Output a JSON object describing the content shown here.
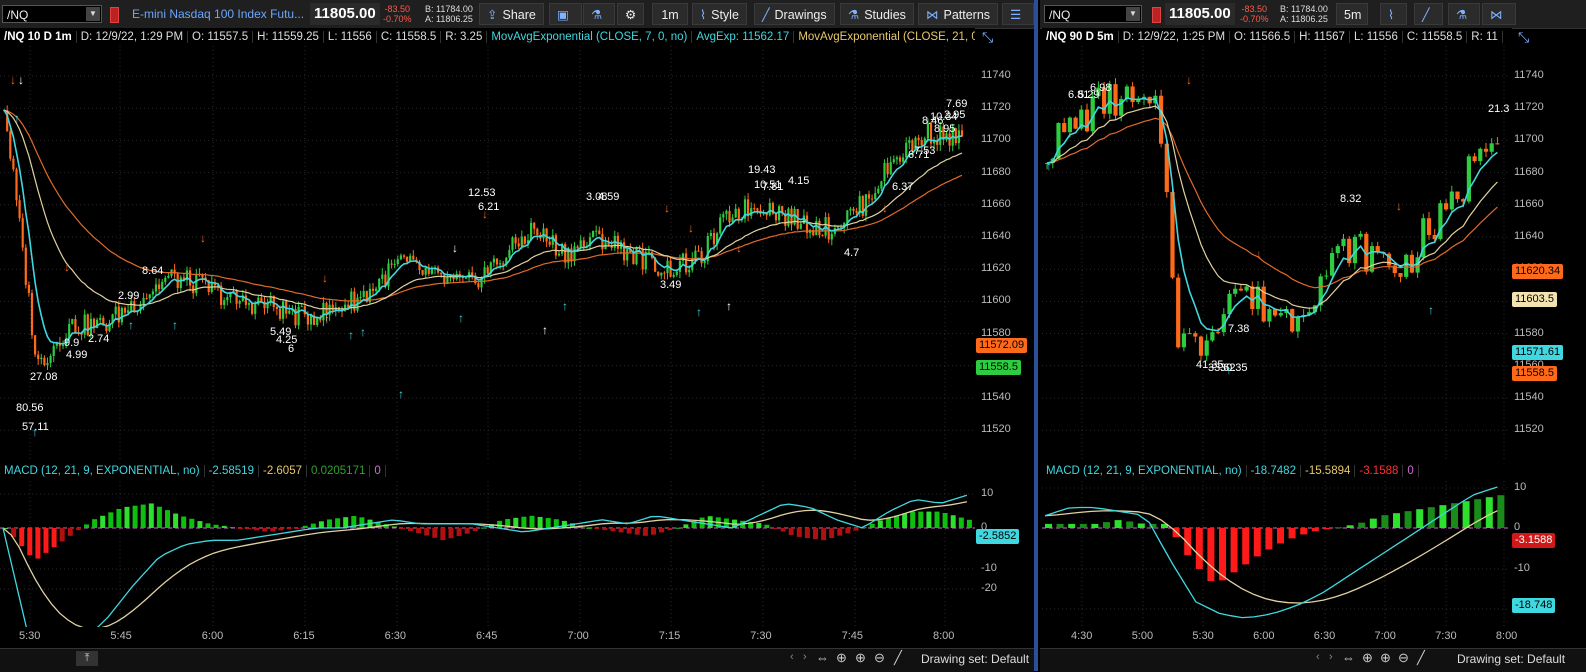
{
  "left": {
    "symbol": "/NQ",
    "description": "E-mini Nasdaq 100 Index Futu...",
    "last_price": "11805.00",
    "change": "-83.50",
    "change_pct": "-0.70%",
    "bid": "B: 11784.00",
    "ask": "A: 11806.25",
    "toolbar": {
      "share": "Share",
      "timeframe": "1m",
      "style": "Style",
      "drawings": "Drawings",
      "studies": "Studies",
      "patterns": "Patterns"
    },
    "header": {
      "title": "/NQ 10 D 1m",
      "date": "D: 12/9/22, 1:29 PM",
      "open": "O: 11557.5",
      "high": "H: 11559.25",
      "low": "L: 11556",
      "close": "C: 11558.5",
      "range": "R: 3.25",
      "study1": "MovAvgExponential (CLOSE, 7, 0, no)",
      "study1_val": "AvgExp: 11562.17",
      "study2": "MovAvgExponential (CLOSE, 21, 0,..."
    },
    "price_axis": [
      "11740",
      "11720",
      "11700",
      "11680",
      "11660",
      "11640",
      "11620",
      "11600",
      "11580",
      "11560",
      "11540",
      "11520"
    ],
    "price_tags": {
      "tag1": "11572.09",
      "tag2": "11558.5"
    },
    "annotations": [
      "80.56",
      "57.11",
      "27.08",
      "9.9",
      "4.99",
      "2.74",
      "2.99",
      "8.64",
      "5.49",
      "4.25",
      "6",
      "12.53",
      "6.21",
      "3.08",
      "4.59",
      "3.49",
      "19.43",
      "10.51",
      "7.81",
      "4.15",
      "4.7",
      "6.37",
      "6.71",
      "7.53",
      "8.46",
      "10.34",
      "8.95",
      "2.95",
      "7.69"
    ],
    "macd": {
      "label": "MACD (12, 21, 9, EXPONENTIAL, no)",
      "v1": "-2.58519",
      "v2": "-2.6057",
      "v3": "0.0205171",
      "v4": "0",
      "tag": "-2.5852",
      "axis": [
        "10",
        "0",
        "-10",
        "-20"
      ]
    },
    "time_axis": [
      "5:30",
      "5:45",
      "6:00",
      "6:15",
      "6:30",
      "6:45",
      "7:00",
      "7:15",
      "7:30",
      "7:45",
      "8:00"
    ]
  },
  "right": {
    "symbol": "/NQ",
    "last_price": "11805.00",
    "change": "-83.50",
    "change_pct": "-0.70%",
    "bid": "B: 11784.00",
    "ask": "A: 11806.25",
    "timeframe": "5m",
    "header": {
      "title": "/NQ 90 D 5m",
      "date": "D: 12/9/22, 1:25 PM",
      "open": "O: 11566.5",
      "high": "H: 11567",
      "low": "L: 11556",
      "close": "C: 11558.5",
      "range": "R: 11"
    },
    "price_axis": [
      "11740",
      "11720",
      "11700",
      "11680",
      "11660",
      "11640",
      "11620",
      "11600",
      "11580",
      "11560",
      "11540",
      "11520"
    ],
    "price_tags": {
      "tag1": "11620.34",
      "tag2": "11603.5",
      "tag3": "11571.61",
      "tag4": "11558.5"
    },
    "annotations": [
      "6.81",
      "5.29",
      "6.98",
      "41.35",
      "33.62",
      "30.35",
      "7.38",
      "8.32",
      "21.3"
    ],
    "macd": {
      "label": "MACD (12, 21, 9, EXPONENTIAL, no)",
      "v1": "-18.7482",
      "v2": "-15.5894",
      "v3": "-3.1588",
      "v4": "0",
      "tag1": "-3.1588",
      "tag2": "-18.748",
      "axis": [
        "10",
        "0",
        "-10",
        "-20"
      ]
    },
    "time_axis": [
      "4:30",
      "5:00",
      "5:30",
      "6:00",
      "6:30",
      "7:00",
      "7:30",
      "8:00"
    ]
  },
  "footer": {
    "drawing_set_left": "Drawing set: Default",
    "drawing_set_right": "Drawing set: Default"
  },
  "colors": {
    "up": "#2ecc40",
    "down": "#ff6a1a",
    "ema7": "#3fd8e0",
    "ema21": "#e0d2a0",
    "ema_slow": "#e06a2a",
    "accent": "#3a7bd5"
  }
}
